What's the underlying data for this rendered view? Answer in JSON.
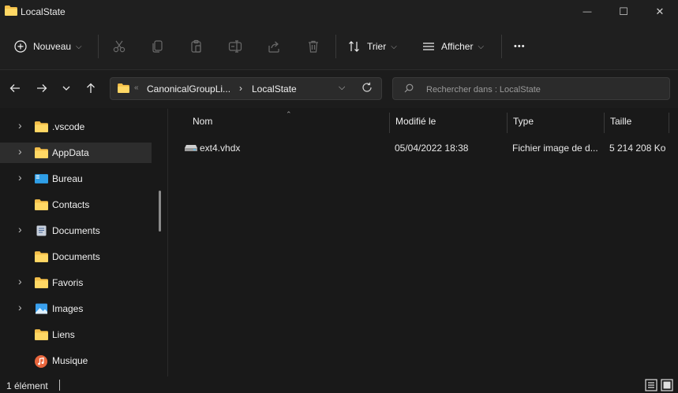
{
  "window": {
    "title": "LocalState",
    "min_glyph": "—",
    "max_glyph": "☐",
    "close_glyph": "✕"
  },
  "toolbar": {
    "new_label": "Nouveau",
    "sort_label": "Trier",
    "view_label": "Afficher",
    "more_label": "•••",
    "icons": [
      "cut-icon",
      "copy-icon",
      "paste-icon",
      "rename-icon",
      "share-icon",
      "delete-icon"
    ]
  },
  "address": {
    "overflow": "«",
    "segment1": "CanonicalGroupLi...",
    "separator": "›",
    "segment2": "LocalState"
  },
  "search": {
    "placeholder": "Rechercher dans : LocalState"
  },
  "sidebar": {
    "items": [
      {
        "label": ".vscode",
        "icon": "folder-icon",
        "expandable": true
      },
      {
        "label": "AppData",
        "icon": "folder-icon",
        "expandable": true,
        "selected": true
      },
      {
        "label": "Bureau",
        "icon": "desktop-icon",
        "expandable": true
      },
      {
        "label": "Contacts",
        "icon": "folder-icon",
        "expandable": false
      },
      {
        "label": "Documents",
        "icon": "documents-icon",
        "expandable": true
      },
      {
        "label": "Documents",
        "icon": "folder-icon",
        "expandable": false
      },
      {
        "label": "Favoris",
        "icon": "folder-icon",
        "expandable": true
      },
      {
        "label": "Images",
        "icon": "pictures-icon",
        "expandable": true
      },
      {
        "label": "Liens",
        "icon": "folder-icon",
        "expandable": false
      },
      {
        "label": "Musique",
        "icon": "music-icon",
        "expandable": false
      }
    ]
  },
  "filelist": {
    "columns": {
      "name": "Nom",
      "modified": "Modifié le",
      "type": "Type",
      "size": "Taille"
    },
    "rows": [
      {
        "name": "ext4.vhdx",
        "modified": "05/04/2022 18:38",
        "type": "Fichier image de d...",
        "size": "5 214 208 Ko"
      }
    ]
  },
  "status": {
    "count": "1 élément"
  },
  "colors": {
    "background": "#191919",
    "folder": "#f5c04a",
    "accent": "#4cc2ff"
  }
}
